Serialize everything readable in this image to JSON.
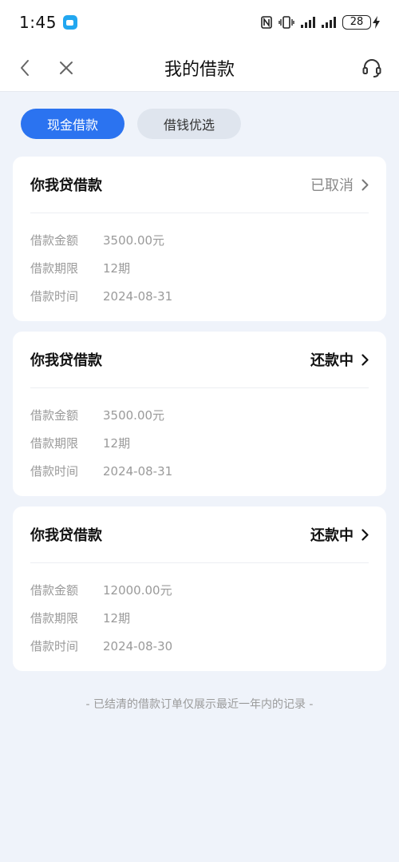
{
  "status_bar": {
    "time": "1:45",
    "battery": "28"
  },
  "header": {
    "title": "我的借款"
  },
  "tabs": [
    {
      "label": "现金借款",
      "active": true
    },
    {
      "label": "借钱优选",
      "active": false
    }
  ],
  "loans": [
    {
      "title": "你我贷借款",
      "status": "已取消",
      "status_type": "cancelled",
      "rows": [
        {
          "label": "借款金额",
          "value": "3500.00元"
        },
        {
          "label": "借款期限",
          "value": "12期"
        },
        {
          "label": "借款时间",
          "value": "2024-08-31"
        }
      ]
    },
    {
      "title": "你我贷借款",
      "status": "还款中",
      "status_type": "repaying",
      "rows": [
        {
          "label": "借款金额",
          "value": "3500.00元"
        },
        {
          "label": "借款期限",
          "value": "12期"
        },
        {
          "label": "借款时间",
          "value": "2024-08-31"
        }
      ]
    },
    {
      "title": "你我贷借款",
      "status": "还款中",
      "status_type": "repaying",
      "rows": [
        {
          "label": "借款金额",
          "value": "12000.00元"
        },
        {
          "label": "借款期限",
          "value": "12期"
        },
        {
          "label": "借款时间",
          "value": "2024-08-30"
        }
      ]
    }
  ],
  "footer": {
    "note": "- 已结清的借款订单仅展示最近一年内的记录 -"
  },
  "colors": {
    "accent": "#2b73f0",
    "background": "#eff3fa"
  }
}
